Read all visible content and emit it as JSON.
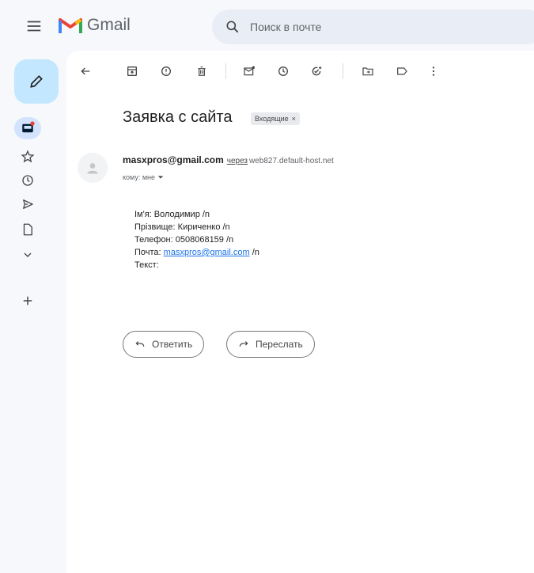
{
  "header": {
    "app_name": "Gmail",
    "search_placeholder": "Поиск в почте"
  },
  "colors": {
    "gmail_red": "#ea4335",
    "gmail_blue": "#4285f4",
    "gmail_green": "#34a853",
    "gmail_yellow": "#fbbc04",
    "compose_bg": "#c2e7ff",
    "link": "#1a73e8"
  },
  "sidebar": {
    "icons": [
      "menu-icon",
      "pencil-icon",
      "inbox-icon",
      "star-icon",
      "clock-icon",
      "send-icon",
      "draft-icon",
      "chevron-down-icon",
      "plus-icon"
    ]
  },
  "toolbar": {
    "icons": [
      "back-arrow-icon",
      "archive-icon",
      "report-spam-icon",
      "delete-icon",
      "mark-unread-icon",
      "snooze-icon",
      "add-task-icon",
      "move-to-icon",
      "label-icon",
      "more-vert-icon"
    ]
  },
  "email": {
    "subject": "Заявка с сайта",
    "label": "Входящие",
    "label_close": "×",
    "sender_email": "masxpros@gmail.com",
    "via_text": "через",
    "via_host": "web827.default-host.net",
    "to_text": "кому: мне",
    "body": {
      "line1": "Ім'я: Володимир /n",
      "line2": "Прізвище: Кириченко /n",
      "line3": "Телефон: 0508068159 /n",
      "line4_prefix": "Почта: ",
      "line4_link": "masxpros@gmail.com",
      "line4_suffix": " /n",
      "line5": "Текст:"
    }
  },
  "actions": {
    "reply": "Ответить",
    "forward": "Переслать"
  }
}
